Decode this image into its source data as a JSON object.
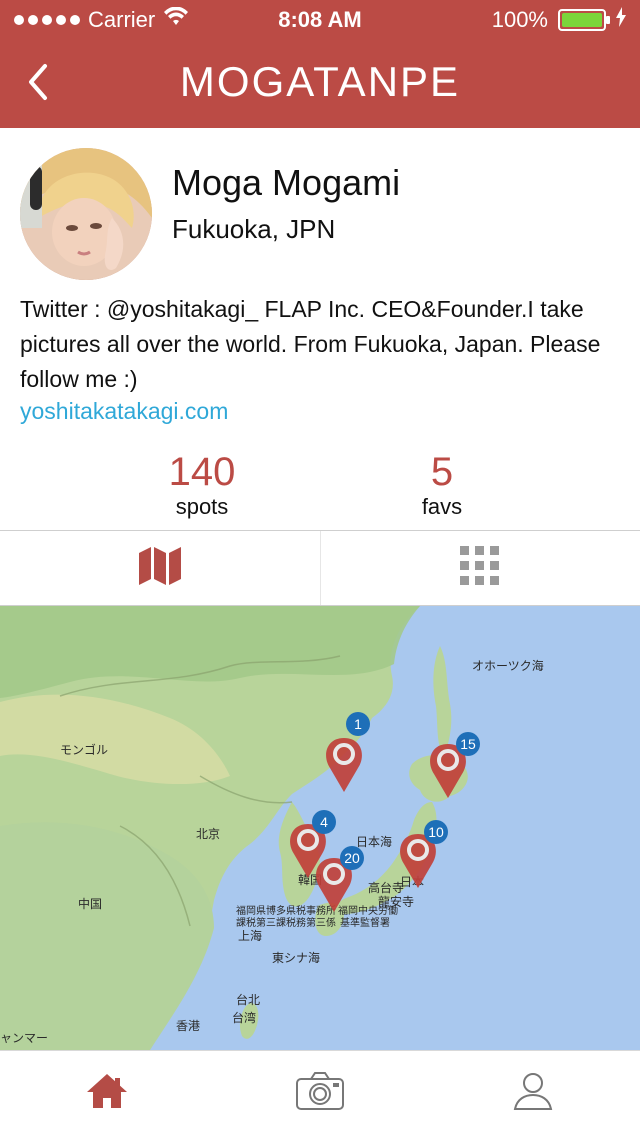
{
  "status_bar": {
    "carrier": "Carrier",
    "time": "8:08 AM",
    "battery": "100%",
    "colors": {
      "battery_fill": "#7bd53a"
    }
  },
  "nav": {
    "title": "MOGATANPE",
    "back_icon": "chevron-left-icon"
  },
  "profile": {
    "name": "Moga Mogami",
    "location": "Fukuoka, JPN",
    "bio": "Twitter : @yoshitakagi_ FLAP Inc. CEO&Founder.I take pictures all over the world. From Fukuoka, Japan. Please follow me :)",
    "website": "yoshitakatakagi.com",
    "stats": {
      "spots": {
        "value": "140",
        "label": "spots"
      },
      "favs": {
        "value": "5",
        "label": "favs"
      }
    }
  },
  "tabs": [
    {
      "name": "map",
      "icon": "map-icon",
      "selected": true
    },
    {
      "name": "grid",
      "icon": "grid-icon",
      "selected": false
    }
  ],
  "map": {
    "labels": {
      "okhotsk": "オホーツク海",
      "mongolia": "モンゴル",
      "beijing": "北京",
      "china": "中国",
      "japan_sea": "日本海",
      "korea": "韓国",
      "shanghai": "上海",
      "east_china_sea": "東シナ海",
      "japan": "日本",
      "takamatsu": "高台寺",
      "temple": "龍安寺",
      "taipei": "台北",
      "taiwan": "台湾",
      "hongkong": "香港",
      "myanmar": "ャンマー",
      "fukuoka_lines": [
        "福岡県博多県税事務所",
        "課税第三課税務第三係",
        "福岡中央労働",
        "基準監督署"
      ]
    },
    "pins": [
      {
        "count": "1"
      },
      {
        "count": "15"
      },
      {
        "count": "4"
      },
      {
        "count": "20"
      },
      {
        "count": "10"
      }
    ],
    "colors": {
      "pin": "#c0403a",
      "badge": "#1e6fb8",
      "sea": "#a9c8ee",
      "land": "#b8d49a"
    }
  },
  "bottom_bar": [
    {
      "name": "home",
      "icon": "home-icon",
      "selected": true
    },
    {
      "name": "camera",
      "icon": "camera-icon",
      "selected": false
    },
    {
      "name": "profile",
      "icon": "user-icon",
      "selected": false
    }
  ],
  "colors": {
    "brand": "#bb4b45",
    "link": "#2fa8d8"
  }
}
